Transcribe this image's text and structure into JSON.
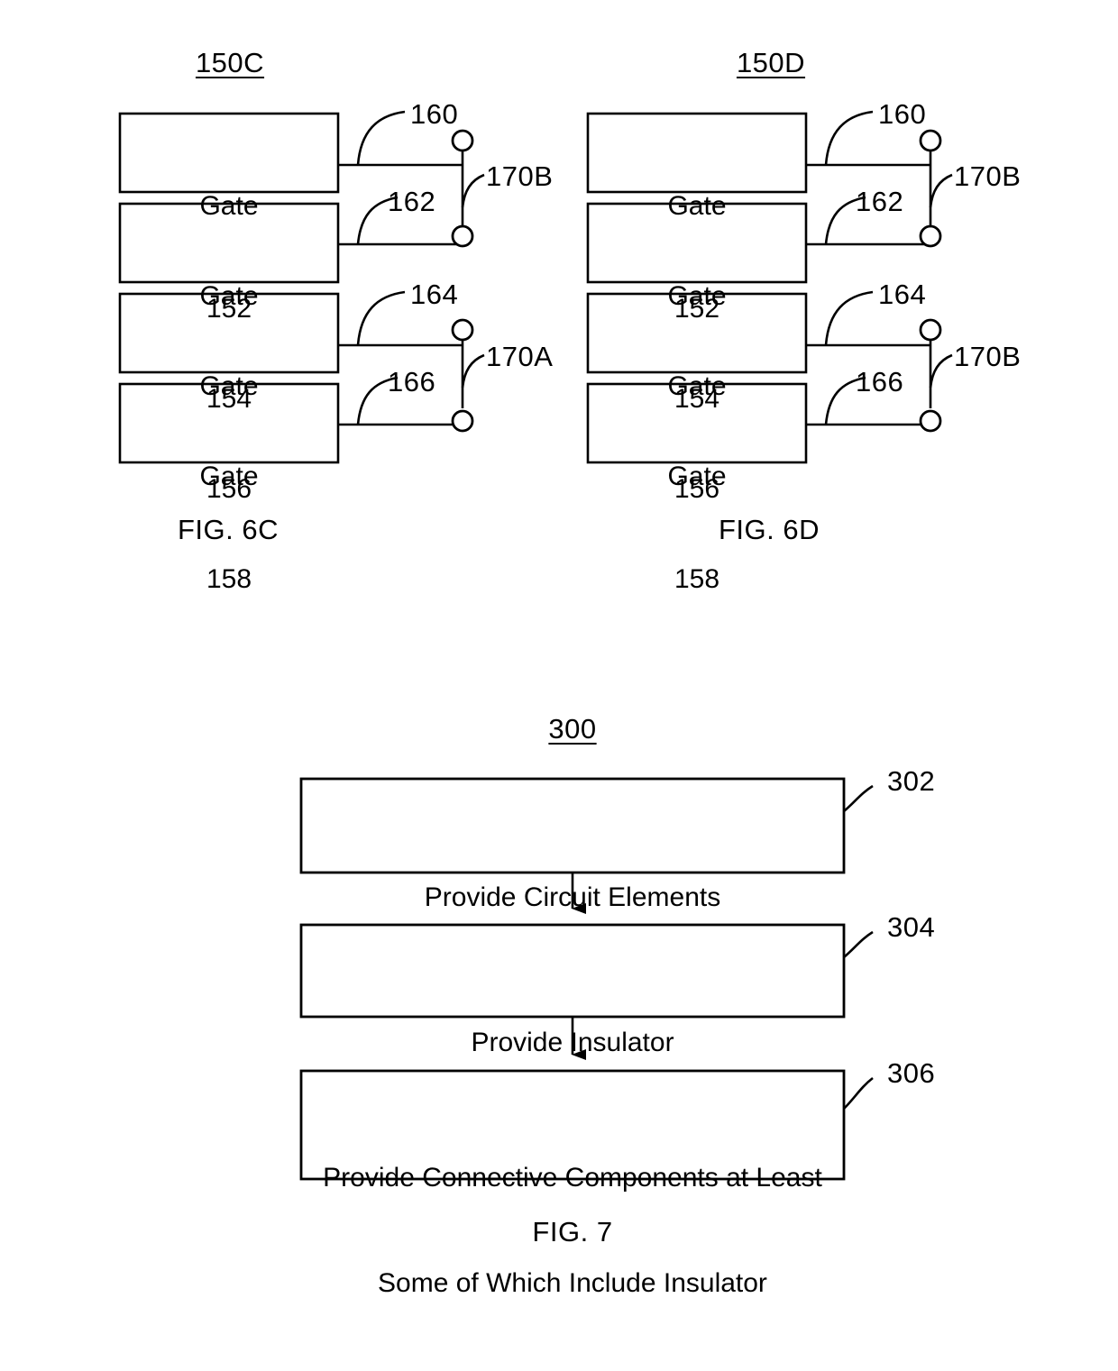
{
  "document": {
    "type": "patent-drawing-sheet",
    "figures": [
      "FIG. 6C",
      "FIG. 6D",
      "FIG. 7"
    ]
  },
  "fig6c": {
    "reference_label": "150C",
    "caption": "FIG. 6C",
    "gates": [
      {
        "name": "Gate",
        "number": "152"
      },
      {
        "name": "Gate",
        "number": "154"
      },
      {
        "name": "Gate",
        "number": "156"
      },
      {
        "name": "Gate",
        "number": "158"
      }
    ],
    "wire_refs": [
      "160",
      "162",
      "164",
      "166"
    ],
    "connector_refs": [
      "170B",
      "170A"
    ]
  },
  "fig6d": {
    "reference_label": "150D",
    "caption": "FIG. 6D",
    "gates": [
      {
        "name": "Gate",
        "number": "152"
      },
      {
        "name": "Gate",
        "number": "154"
      },
      {
        "name": "Gate",
        "number": "156"
      },
      {
        "name": "Gate",
        "number": "158"
      }
    ],
    "wire_refs": [
      "160",
      "162",
      "164",
      "166"
    ],
    "connector_refs": [
      "170B",
      "170B"
    ]
  },
  "fig7": {
    "reference_label": "300",
    "caption": "FIG. 7",
    "steps": [
      {
        "ref": "302",
        "line1": "Provide Circuit Elements",
        "line2": ""
      },
      {
        "ref": "304",
        "line1": "Provide Insulator",
        "line2": ""
      },
      {
        "ref": "306",
        "line1": "Provide Connective Components at Least",
        "line2": "Some of Which Include Insulator"
      }
    ]
  },
  "colors": {
    "ink": "#000000",
    "paper": "#ffffff"
  }
}
